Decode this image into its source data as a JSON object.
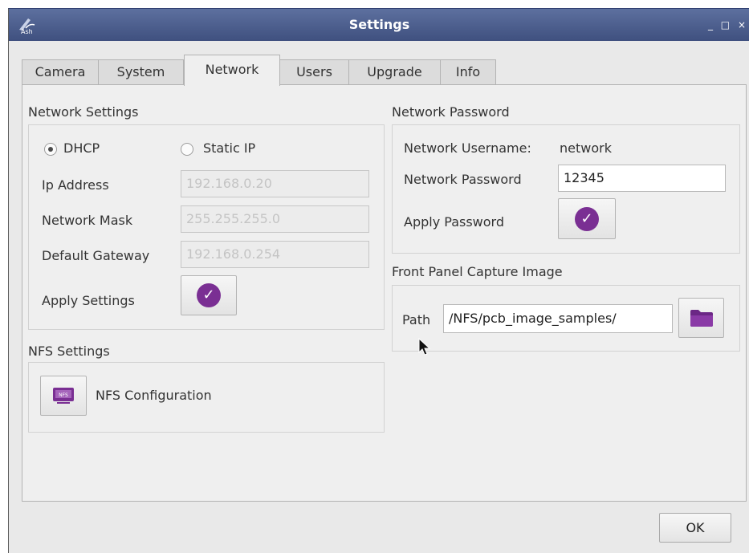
{
  "window": {
    "title": "Settings",
    "app_icon_label": "Ash",
    "controls": {
      "minimize": "_",
      "maximize": "□",
      "close": "×"
    }
  },
  "tabs": [
    {
      "label": "Camera",
      "active": false
    },
    {
      "label": "System",
      "active": false
    },
    {
      "label": "Network",
      "active": true
    },
    {
      "label": "Users",
      "active": false
    },
    {
      "label": "Upgrade",
      "active": false
    },
    {
      "label": "Info",
      "active": false
    }
  ],
  "network_settings": {
    "title": "Network Settings",
    "mode_options": [
      {
        "label": "DHCP",
        "selected": true
      },
      {
        "label": "Static IP",
        "selected": false
      }
    ],
    "ip_label": "Ip Address",
    "ip_value": "192.168.0.20",
    "mask_label": "Network Mask",
    "mask_value": "255.255.255.0",
    "gateway_label": "Default Gateway",
    "gateway_value": "192.168.0.254",
    "apply_label": "Apply Settings"
  },
  "nfs_settings": {
    "title": "NFS Settings",
    "button_label": "NFS Configuration",
    "icon_text": "NFS"
  },
  "network_password": {
    "title": "Network Password",
    "username_label": "Network Username:",
    "username_value": "network",
    "password_label": "Network Password",
    "password_value": "12345",
    "apply_label": "Apply Password"
  },
  "front_panel": {
    "title": "Front Panel Capture Image",
    "path_label": "Path",
    "path_value": "/NFS/pcb_image_samples/"
  },
  "footer": {
    "ok_label": "OK"
  },
  "colors": {
    "titlebar": "#4a5b8a",
    "accent_purple": "#7a2f93",
    "panel_bg": "#efefef"
  }
}
